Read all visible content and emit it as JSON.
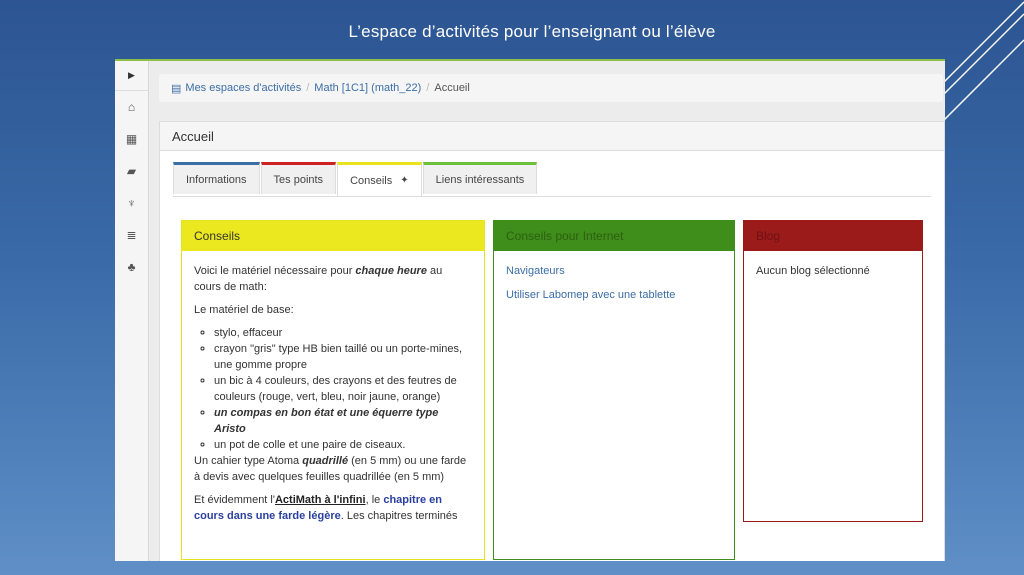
{
  "slide": {
    "title": "L’espace d’activités pour  l’enseignant ou l’élève"
  },
  "sidebar": {
    "toggle_icon": "chevron-right-icon",
    "items": [
      {
        "icon": "home-icon",
        "glyph": "⌂"
      },
      {
        "icon": "calendar-icon",
        "glyph": "▦"
      },
      {
        "icon": "folder-open-icon",
        "glyph": "▰"
      },
      {
        "icon": "trophy-icon",
        "glyph": "♆"
      },
      {
        "icon": "list-icon",
        "glyph": "≣"
      },
      {
        "icon": "users-icon",
        "glyph": "♣"
      }
    ]
  },
  "breadcrumb": {
    "book_icon": "▤",
    "item1": "Mes espaces d'activités",
    "item2": "Math [1C1] (math_22)",
    "current": "Accueil"
  },
  "panel": {
    "title": "Accueil"
  },
  "tabs": [
    {
      "label": "Informations",
      "color": "#3b6ea5"
    },
    {
      "label": "Tes points",
      "color": "#cc2222"
    },
    {
      "label": "Conseils",
      "color": "#e9e31f",
      "pin": "✦"
    },
    {
      "label": "Liens intéressants",
      "color": "#6bbf3a"
    }
  ],
  "conseils": {
    "title": "Conseils",
    "p1_a": "Voici le matériel nécessaire pour ",
    "p1_b": "chaque heure",
    "p1_c": " au cours de math:",
    "p2": "Le matériel de base:",
    "items": [
      "stylo, effaceur",
      "crayon \"gris\" type HB bien taillé ou un porte-mines, une gomme propre",
      "un bic à 4 couleurs, des crayons et des feutres de couleurs (rouge, vert, bleu, noir jaune, orange)",
      "un compas en bon état et une équerre type Aristo",
      "un pot de colle et une paire de ciseaux."
    ],
    "p3_a": "Un cahier type Atoma ",
    "p3_b": "quadrillé",
    "p3_c": " (en 5 mm) ou une farde à devis avec quelques feuilles quadrillée (en 5 mm)",
    "p4_a": "Et évidemment l'",
    "p4_b": "ActiMath à l'infini",
    "p4_c": ", le ",
    "p4_d": "chapitre en cours dans une farde légère",
    "p4_e": ". Les chapitres terminés"
  },
  "internet": {
    "title": "Conseils pour Internet",
    "links": [
      "Navigateurs",
      "Utiliser Labomep avec une tablette"
    ]
  },
  "blog": {
    "title": "Blog",
    "text": "Aucun blog sélectionné"
  }
}
